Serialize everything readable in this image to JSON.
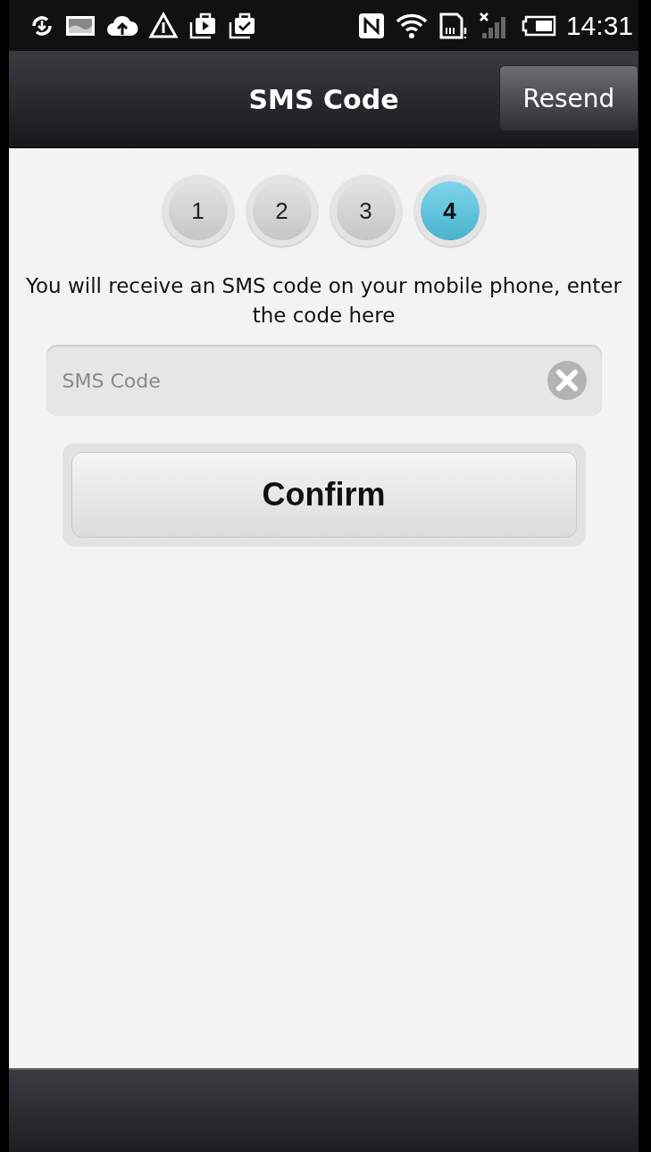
{
  "status_bar": {
    "time": "14:31"
  },
  "header": {
    "title": "SMS Code",
    "resend_button": "Resend"
  },
  "steps": [
    {
      "label": "1",
      "selected": false
    },
    {
      "label": "2",
      "selected": false
    },
    {
      "label": "3",
      "selected": false
    },
    {
      "label": "4",
      "selected": true
    }
  ],
  "instruction": "You will receive an SMS code on your mobile phone, enter the code here",
  "code_field": {
    "placeholder": "SMS Code"
  },
  "confirm_button": "Confirm"
}
